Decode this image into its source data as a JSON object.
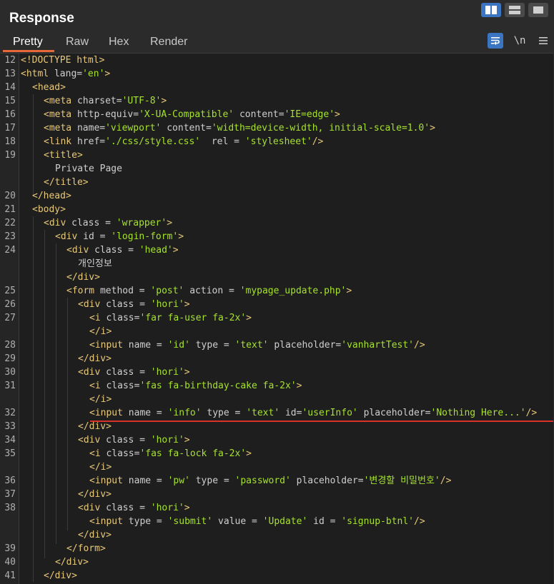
{
  "panel": {
    "title": "Response"
  },
  "tabs": [
    "Pretty",
    "Raw",
    "Hex",
    "Render"
  ],
  "toolbar": {
    "newline_label": "\\n"
  },
  "colors": {
    "accent_blue": "#3b74c1",
    "active_tab_underline": "#e8683a",
    "highlight_line": "#d9322b",
    "string_color": "#a6e22e",
    "tag_color": "#e8c97a"
  },
  "icons": {
    "layout_split": "split-view-icon",
    "layout_horizontal": "horizontal-view-icon",
    "layout_single": "single-view-icon",
    "wrap": "word-wrap-icon",
    "menu": "hamburger-menu-icon"
  },
  "lines": [
    {
      "n": "12",
      "indent": 0,
      "parts": [
        [
          "tag",
          "<!DOCTYPE html>"
        ]
      ]
    },
    {
      "n": "13",
      "indent": 0,
      "parts": [
        [
          "tag",
          "<html "
        ],
        [
          "attr",
          "lang="
        ],
        [
          "str",
          "'en'"
        ],
        [
          "tag",
          ">"
        ]
      ]
    },
    {
      "n": "14",
      "indent": 1,
      "parts": [
        [
          "tag",
          "<head>"
        ]
      ]
    },
    {
      "n": "15",
      "indent": 2,
      "parts": [
        [
          "tag",
          "<meta "
        ],
        [
          "attr",
          "charset="
        ],
        [
          "str",
          "'UTF-8'"
        ],
        [
          "tag",
          ">"
        ]
      ]
    },
    {
      "n": "16",
      "indent": 2,
      "parts": [
        [
          "tag",
          "<meta "
        ],
        [
          "attr",
          "http-equiv="
        ],
        [
          "str",
          "'X-UA-Compatible'"
        ],
        [
          "attr",
          " content="
        ],
        [
          "str",
          "'IE=edge'"
        ],
        [
          "tag",
          ">"
        ]
      ]
    },
    {
      "n": "17",
      "indent": 2,
      "parts": [
        [
          "tag",
          "<meta "
        ],
        [
          "attr",
          "name="
        ],
        [
          "str",
          "'viewport'"
        ],
        [
          "attr",
          " content="
        ],
        [
          "str",
          "'width=device-width, initial-scale=1.0'"
        ],
        [
          "tag",
          ">"
        ]
      ]
    },
    {
      "n": "18",
      "indent": 2,
      "parts": [
        [
          "tag",
          "<link "
        ],
        [
          "attr",
          "href="
        ],
        [
          "str",
          "'./css/style.css'"
        ],
        [
          "attr",
          "  rel = "
        ],
        [
          "str",
          "'stylesheet'"
        ],
        [
          "tag",
          "/>"
        ]
      ]
    },
    {
      "n": "19",
      "indent": 2,
      "parts": [
        [
          "tag",
          "<title>"
        ]
      ]
    },
    {
      "n": "",
      "indent": 3,
      "parts": [
        [
          "attr",
          "Private Page"
        ]
      ]
    },
    {
      "n": "",
      "indent": 2,
      "parts": [
        [
          "tag",
          "</title>"
        ]
      ]
    },
    {
      "n": "20",
      "indent": 1,
      "parts": [
        [
          "tag",
          "</head>"
        ]
      ]
    },
    {
      "n": "21",
      "indent": 1,
      "parts": [
        [
          "tag",
          "<body>"
        ]
      ]
    },
    {
      "n": "22",
      "indent": 2,
      "parts": [
        [
          "tag",
          "<div "
        ],
        [
          "attr",
          "class = "
        ],
        [
          "str",
          "'wrapper'"
        ],
        [
          "tag",
          ">"
        ]
      ]
    },
    {
      "n": "23",
      "indent": 3,
      "parts": [
        [
          "tag",
          "<div "
        ],
        [
          "attr",
          "id = "
        ],
        [
          "str",
          "'login-form'"
        ],
        [
          "tag",
          ">"
        ]
      ]
    },
    {
      "n": "24",
      "indent": 4,
      "parts": [
        [
          "tag",
          "<div "
        ],
        [
          "attr",
          "class = "
        ],
        [
          "str",
          "'head'"
        ],
        [
          "tag",
          ">"
        ]
      ]
    },
    {
      "n": "",
      "indent": 5,
      "parts": [
        [
          "attr",
          "개인정보"
        ]
      ]
    },
    {
      "n": "",
      "indent": 4,
      "parts": [
        [
          "tag",
          "</div>"
        ]
      ]
    },
    {
      "n": "25",
      "indent": 4,
      "parts": [
        [
          "tag",
          "<form "
        ],
        [
          "attr",
          "method = "
        ],
        [
          "str",
          "'post'"
        ],
        [
          "attr",
          " action = "
        ],
        [
          "str",
          "'mypage_update.php'"
        ],
        [
          "tag",
          ">"
        ]
      ]
    },
    {
      "n": "26",
      "indent": 5,
      "parts": [
        [
          "tag",
          "<div "
        ],
        [
          "attr",
          "class = "
        ],
        [
          "str",
          "'hori'"
        ],
        [
          "tag",
          ">"
        ]
      ]
    },
    {
      "n": "27",
      "indent": 6,
      "parts": [
        [
          "tag",
          "<i "
        ],
        [
          "attr",
          "class="
        ],
        [
          "str",
          "'far fa-user fa-2x'"
        ],
        [
          "tag",
          ">"
        ]
      ]
    },
    {
      "n": "",
      "indent": 6,
      "parts": [
        [
          "tag",
          "</i>"
        ]
      ]
    },
    {
      "n": "28",
      "indent": 6,
      "parts": [
        [
          "tag",
          "<input "
        ],
        [
          "attr",
          "name = "
        ],
        [
          "str",
          "'id'"
        ],
        [
          "attr",
          " type = "
        ],
        [
          "str",
          "'text'"
        ],
        [
          "attr",
          " placeholder="
        ],
        [
          "str",
          "'vanhartTest'"
        ],
        [
          "tag",
          "/>"
        ]
      ]
    },
    {
      "n": "29",
      "indent": 5,
      "parts": [
        [
          "tag",
          "</div>"
        ]
      ]
    },
    {
      "n": "30",
      "indent": 5,
      "parts": [
        [
          "tag",
          "<div "
        ],
        [
          "attr",
          "class = "
        ],
        [
          "str",
          "'hori'"
        ],
        [
          "tag",
          ">"
        ]
      ]
    },
    {
      "n": "31",
      "indent": 6,
      "parts": [
        [
          "tag",
          "<i "
        ],
        [
          "attr",
          "class="
        ],
        [
          "str",
          "'fas fa-birthday-cake fa-2x'"
        ],
        [
          "tag",
          ">"
        ]
      ]
    },
    {
      "n": "",
      "indent": 6,
      "parts": [
        [
          "tag",
          "</i>"
        ]
      ]
    },
    {
      "n": "32",
      "indent": 6,
      "parts": [
        [
          "tag",
          "<input "
        ],
        [
          "attr",
          "name = "
        ],
        [
          "str",
          "'info'"
        ],
        [
          "attr",
          " type = "
        ],
        [
          "str",
          "'text'"
        ],
        [
          "attr",
          " id="
        ],
        [
          "str",
          "'userInfo'"
        ],
        [
          "attr",
          " placeholder="
        ],
        [
          "str",
          "'Nothing Here...'"
        ],
        [
          "tag",
          "/>"
        ]
      ]
    },
    {
      "n": "33",
      "indent": 5,
      "parts": [
        [
          "tag",
          "</div>"
        ]
      ]
    },
    {
      "n": "34",
      "indent": 5,
      "parts": [
        [
          "tag",
          "<div "
        ],
        [
          "attr",
          "class = "
        ],
        [
          "str",
          "'hori'"
        ],
        [
          "tag",
          ">"
        ]
      ]
    },
    {
      "n": "35",
      "indent": 6,
      "parts": [
        [
          "tag",
          "<i "
        ],
        [
          "attr",
          "class="
        ],
        [
          "str",
          "'fas fa-lock fa-2x'"
        ],
        [
          "tag",
          ">"
        ]
      ]
    },
    {
      "n": "",
      "indent": 6,
      "parts": [
        [
          "tag",
          "</i>"
        ]
      ]
    },
    {
      "n": "36",
      "indent": 6,
      "parts": [
        [
          "tag",
          "<input "
        ],
        [
          "attr",
          "name = "
        ],
        [
          "str",
          "'pw'"
        ],
        [
          "attr",
          " type = "
        ],
        [
          "str",
          "'password'"
        ],
        [
          "attr",
          " placeholder="
        ],
        [
          "str",
          "'변경할 비밀번호'"
        ],
        [
          "tag",
          "/>"
        ]
      ]
    },
    {
      "n": "37",
      "indent": 5,
      "parts": [
        [
          "tag",
          "</div>"
        ]
      ]
    },
    {
      "n": "38",
      "indent": 5,
      "parts": [
        [
          "tag",
          "<div "
        ],
        [
          "attr",
          "class = "
        ],
        [
          "str",
          "'hori'"
        ],
        [
          "tag",
          ">"
        ]
      ]
    },
    {
      "n": "",
      "indent": 6,
      "parts": [
        [
          "tag",
          "<input "
        ],
        [
          "attr",
          "type = "
        ],
        [
          "str",
          "'submit'"
        ],
        [
          "attr",
          " value = "
        ],
        [
          "str",
          "'Update'"
        ],
        [
          "attr",
          " id = "
        ],
        [
          "str",
          "'signup-btnl'"
        ],
        [
          "tag",
          "/>"
        ]
      ]
    },
    {
      "n": "",
      "indent": 5,
      "parts": [
        [
          "tag",
          "</div>"
        ]
      ]
    },
    {
      "n": "39",
      "indent": 4,
      "parts": [
        [
          "tag",
          "</form>"
        ]
      ]
    },
    {
      "n": "40",
      "indent": 3,
      "parts": [
        [
          "tag",
          "</div>"
        ]
      ]
    },
    {
      "n": "41",
      "indent": 2,
      "parts": [
        [
          "tag",
          "</div>"
        ]
      ]
    }
  ]
}
